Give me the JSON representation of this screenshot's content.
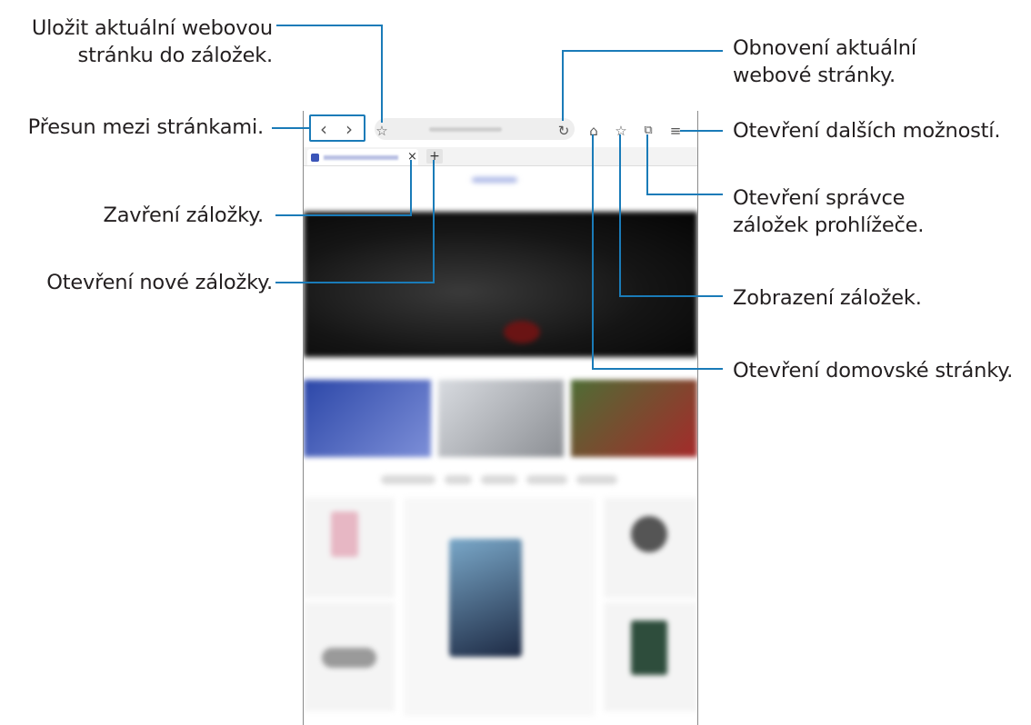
{
  "callouts": {
    "bookmark_save_line1": "Uložit aktuální webovou",
    "bookmark_save_line2": "stránku do záložek.",
    "navigate": "Přesun mezi stránkami.",
    "close_tab": "Zavření záložky.",
    "new_tab": "Otevření nové záložky.",
    "refresh_line1": "Obnovení aktuální",
    "refresh_line2": "webové stránky.",
    "more_options": "Otevření dalších možností.",
    "tab_manager_line1": "Otevření správce",
    "tab_manager_line2": "záložek prohlížeče.",
    "bookmarks": "Zobrazení záložek.",
    "home": "Otevření domovské stránky."
  },
  "browser": {
    "back_icon": "‹",
    "forward_icon": "›",
    "bookmark_star_icon": "☆",
    "refresh_icon": "↻",
    "home_icon": "⌂",
    "bookmarks_icon": "☆",
    "tabs_icon": "⧉",
    "menu_icon": "≡",
    "tab_close_icon": "×",
    "new_tab_icon": "+"
  },
  "colors": {
    "callout_line": "#1a7bb8",
    "text": "#231f20"
  }
}
